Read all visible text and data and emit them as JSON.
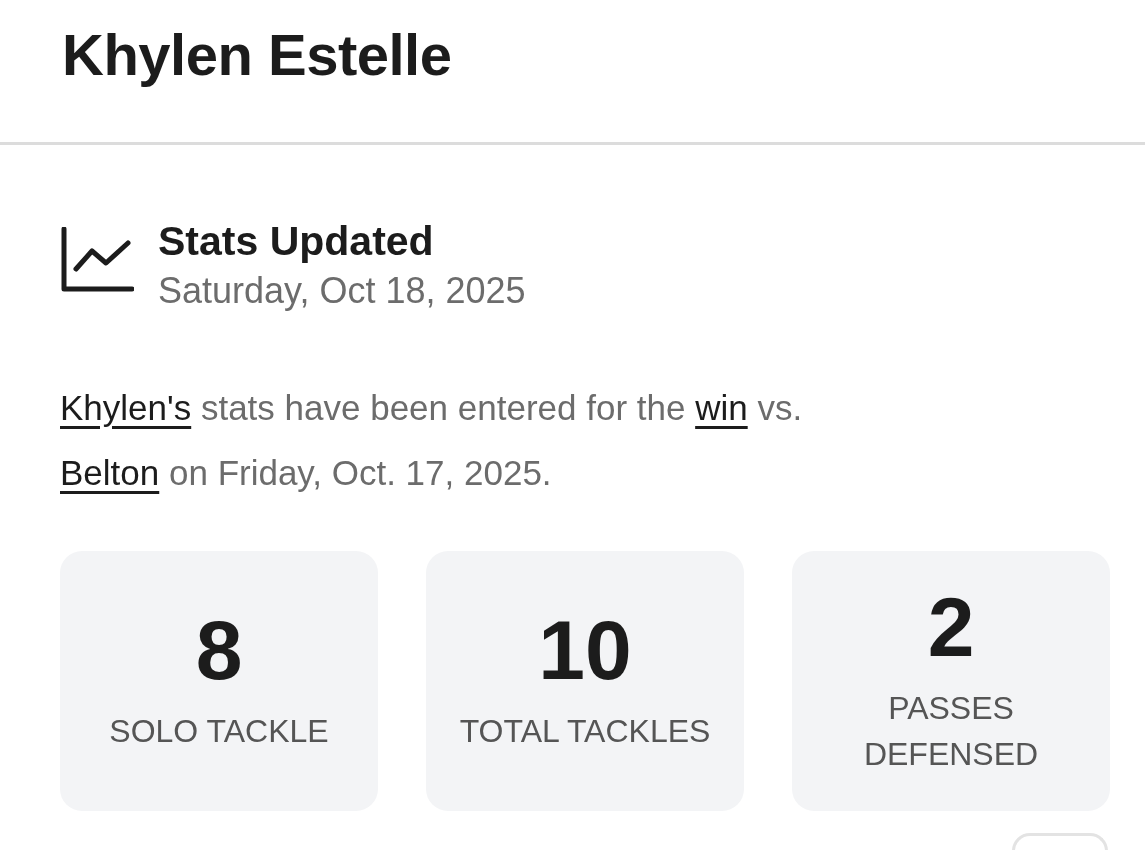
{
  "title": "Khylen Estelle",
  "update": {
    "heading": "Stats Updated",
    "date": "Saturday, Oct 18, 2025"
  },
  "message": [
    {
      "kind": "link",
      "text": "Khylen's"
    },
    {
      "kind": "text",
      "text": " stats have been entered for the "
    },
    {
      "kind": "link",
      "text": "win"
    },
    {
      "kind": "text",
      "text": " vs. "
    },
    {
      "kind": "link",
      "text": "Belton"
    },
    {
      "kind": "text",
      "text": " on Friday, Oct. 17, 2025."
    }
  ],
  "stats": [
    {
      "value": "8",
      "label": "SOLO TACKLE"
    },
    {
      "value": "10",
      "label": "TOTAL TACKLES"
    },
    {
      "value": "2",
      "label": "PASSES DEFENSED"
    }
  ]
}
